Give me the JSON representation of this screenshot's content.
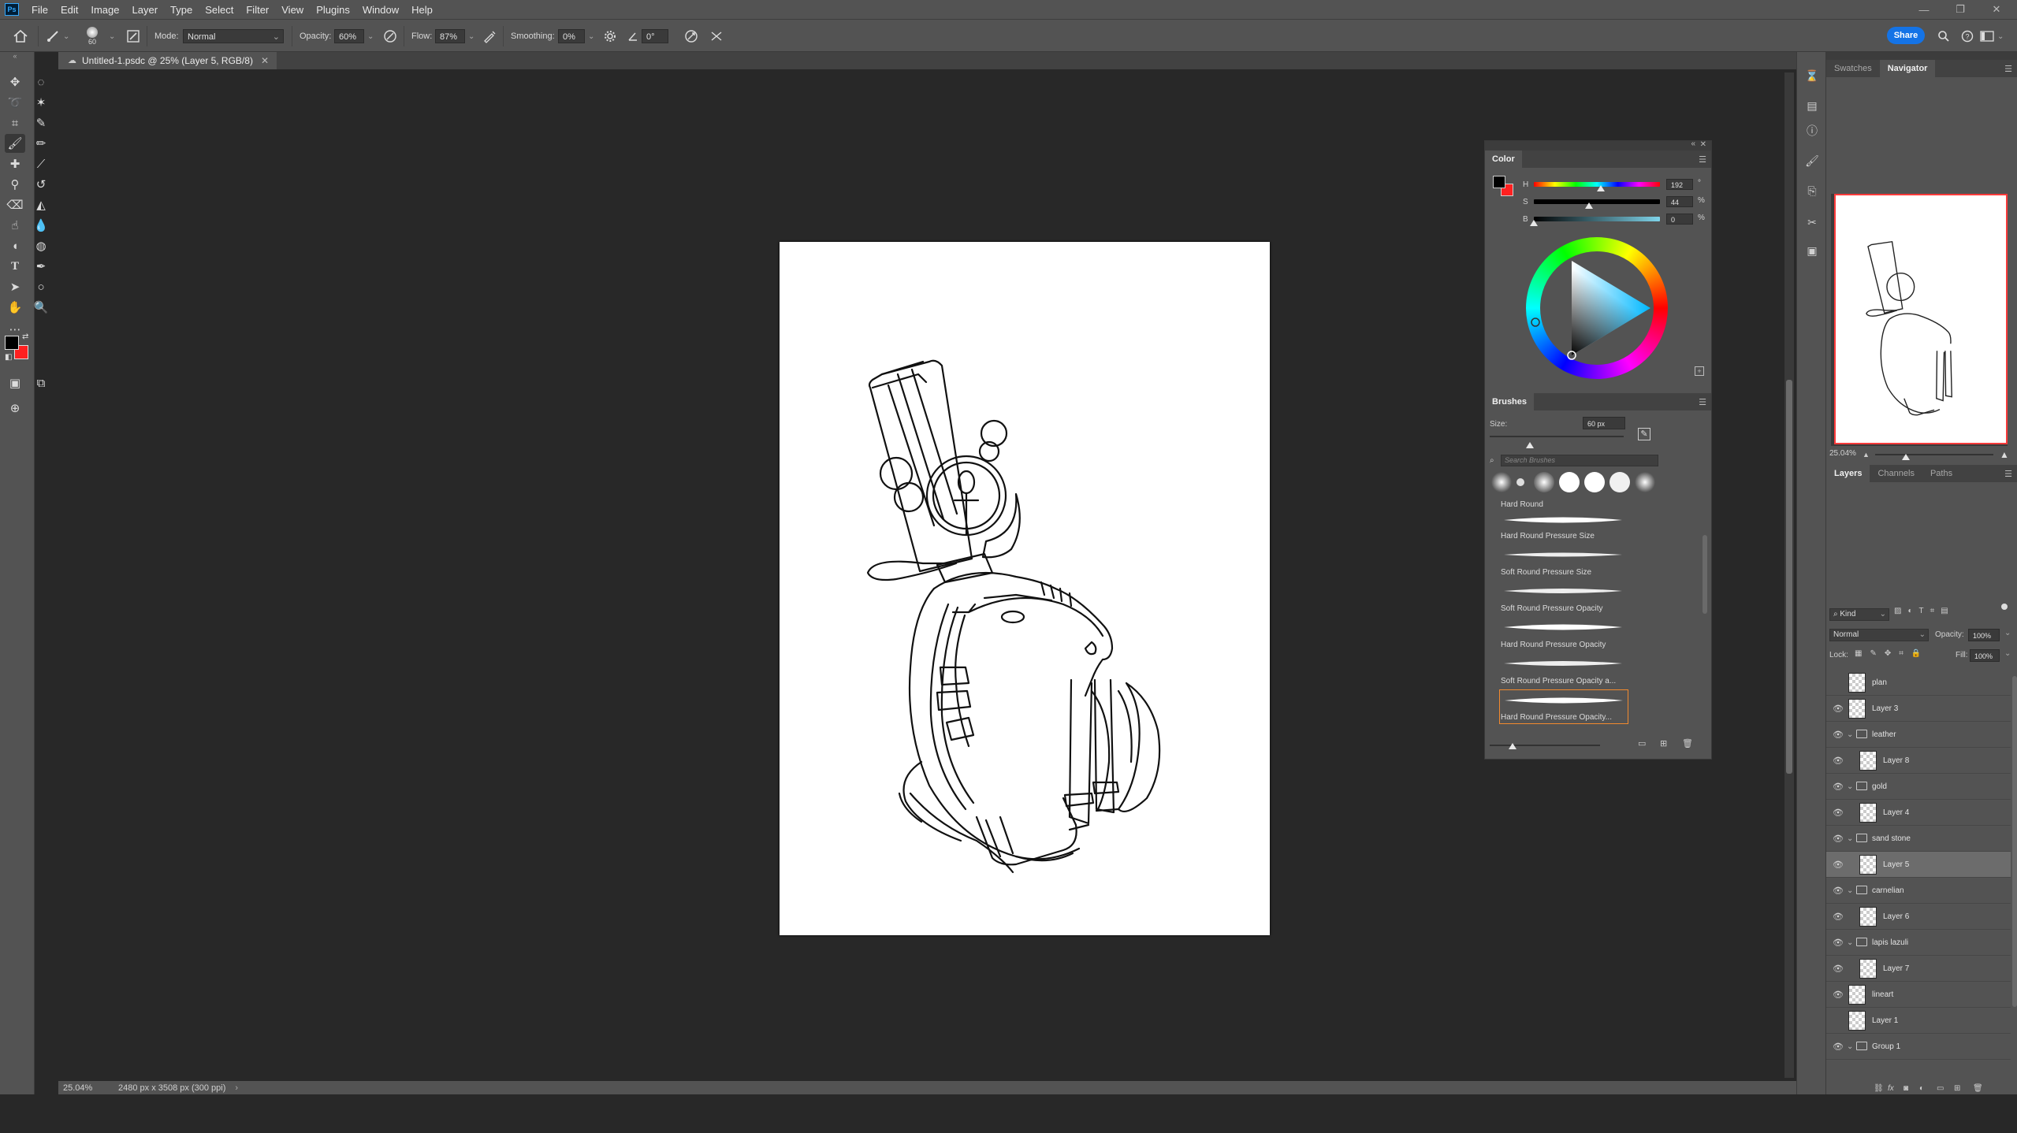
{
  "app": {
    "logo": "Ps",
    "menus": [
      "File",
      "Edit",
      "Image",
      "Layer",
      "Type",
      "Select",
      "Filter",
      "View",
      "Plugins",
      "Window",
      "Help"
    ]
  },
  "options": {
    "brush_size": "60",
    "mode_label": "Mode:",
    "mode_value": "Normal",
    "opacity_label": "Opacity:",
    "opacity_value": "60%",
    "flow_label": "Flow:",
    "flow_value": "87%",
    "smoothing_label": "Smoothing:",
    "smoothing_value": "0%",
    "angle_value": "0°",
    "share_label": "Share"
  },
  "document": {
    "tab_title": "Untitled-1.psdc @ 25% (Layer 5, RGB/8)",
    "zoom": "25.04%",
    "info": "2480 px x 3508 px (300 ppi)",
    "canvas_color": "#ffffff"
  },
  "color_panel": {
    "title": "Color",
    "h_label": "H",
    "s_label": "S",
    "b_label": "B",
    "h_value": "192",
    "s_value": "44",
    "b_value": "0",
    "h_unit": "°",
    "s_unit": "%",
    "b_unit": "%",
    "foreground": "#000000",
    "background": "#ff2020",
    "h_level": 0.53,
    "s_level": 0.44,
    "b_level": 0.0
  },
  "brushes_panel": {
    "title": "Brushes",
    "size_label": "Size:",
    "size_value": "60 px",
    "search_placeholder": "Search Brushes",
    "items": [
      "Hard Round",
      "Hard Round Pressure Size",
      "Soft Round Pressure Size",
      "Soft Round Pressure Opacity",
      "Hard Round Pressure Opacity",
      "Soft Round Pressure Opacity a...",
      "Hard Round Pressure Opacity..."
    ]
  },
  "navigator": {
    "tabs": [
      "Swatches",
      "Navigator"
    ],
    "zoom": "25.04%",
    "view_box_color": "#ff3b3b"
  },
  "layers_panel": {
    "tabs": [
      "Layers",
      "Channels",
      "Paths"
    ],
    "filter_label": "Kind",
    "blend_mode": "Normal",
    "opacity_label": "Opacity:",
    "opacity_value": "100%",
    "lock_label": "Lock:",
    "fill_label": "Fill:",
    "fill_value": "100%",
    "layers": [
      {
        "name": "plan",
        "type": "layer",
        "indent": 0,
        "visible": false
      },
      {
        "name": "Layer 3",
        "type": "layer",
        "indent": 0,
        "visible": true
      },
      {
        "name": "leather",
        "type": "group",
        "indent": 0,
        "visible": true
      },
      {
        "name": "Layer 8",
        "type": "layer",
        "indent": 1,
        "visible": true
      },
      {
        "name": "gold",
        "type": "group",
        "indent": 0,
        "visible": true
      },
      {
        "name": "Layer 4",
        "type": "layer",
        "indent": 1,
        "visible": true
      },
      {
        "name": "sand stone",
        "type": "group",
        "indent": 0,
        "visible": true
      },
      {
        "name": "Layer 5",
        "type": "layer",
        "indent": 1,
        "visible": true,
        "selected": true
      },
      {
        "name": "carnelian",
        "type": "group",
        "indent": 0,
        "visible": true
      },
      {
        "name": "Layer 6",
        "type": "layer",
        "indent": 1,
        "visible": true
      },
      {
        "name": "lapis lazuli",
        "type": "group",
        "indent": 0,
        "visible": true
      },
      {
        "name": "Layer 7",
        "type": "layer",
        "indent": 1,
        "visible": true
      },
      {
        "name": "lineart",
        "type": "layer",
        "indent": 0,
        "visible": true
      },
      {
        "name": "Layer 1",
        "type": "layer",
        "indent": 0,
        "visible": false
      },
      {
        "name": "Group 1",
        "type": "group",
        "indent": 0,
        "visible": true
      }
    ]
  }
}
